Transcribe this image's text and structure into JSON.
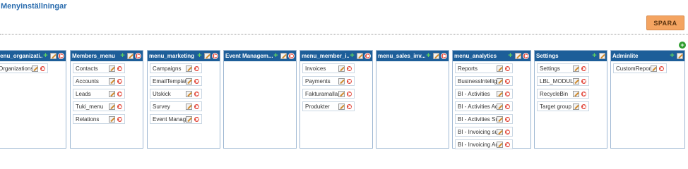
{
  "page": {
    "title": "Menyinställningar",
    "save_label": "SPARA"
  },
  "panels": [
    {
      "id": "org",
      "title": "menu_organizati...",
      "items": [
        "Organizations"
      ]
    },
    {
      "id": "members",
      "title": "Members_menu",
      "items": [
        "Contacts",
        "Accounts",
        "Leads",
        "Tuki_menu",
        "Relations"
      ]
    },
    {
      "id": "marketing",
      "title": "menu_marketing",
      "items": [
        "Campaigns",
        "EmailTemplates",
        "Utskick",
        "Survey",
        "Event Management"
      ]
    },
    {
      "id": "event",
      "title": "Event Managem...",
      "items": []
    },
    {
      "id": "member_i",
      "title": "menu_member_i...",
      "items": [
        "Invoices",
        "Payments",
        "Fakturamallar",
        "Produkter"
      ]
    },
    {
      "id": "sales",
      "title": "menu_sales_inv...",
      "items": []
    },
    {
      "id": "analytics",
      "title": "menu_analytics",
      "items": [
        "Reports",
        "BusinessIntelligence",
        "BI - Activities",
        "BI - Activities AdHoc",
        "BI - Activities Summary",
        "BI - Invoicing summary",
        "BI - Invoicing AdHoc"
      ]
    },
    {
      "id": "settings",
      "title": "Settings",
      "items": [
        "Settings",
        "LBL_MODULE_MANAGER",
        "RecycleBin",
        "Target group"
      ]
    },
    {
      "id": "adminlite",
      "title": "Adminlite",
      "items": [
        "CustomReports"
      ]
    }
  ],
  "icons": {
    "add": "add-icon",
    "edit": "edit-icon",
    "delete": "delete-icon"
  },
  "colors": {
    "header": "#1d5e99",
    "save": "#f4a461",
    "title": "#2a6cae",
    "delete": "#e03b2e",
    "add": "#2f9e2f"
  }
}
